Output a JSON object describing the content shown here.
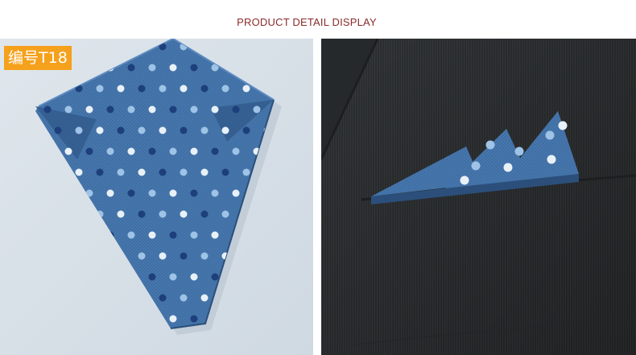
{
  "header": {
    "title": "PRODUCT DETAIL DISPLAY"
  },
  "left_panel": {
    "badge_label": "编号T18",
    "subject": "blue polka-dot pocket square, flat",
    "colors": {
      "background": "#d9e1e8",
      "fabric": "#3f6ea3",
      "dot_light": "#e9f1f8",
      "dot_mid": "#9ec3e6",
      "dot_dark": "#1d3f7c"
    }
  },
  "right_panel": {
    "subject": "pocket square folded in suit breast pocket",
    "colors": {
      "suit": "#2e3133",
      "fabric": "#3f6ea3"
    }
  },
  "colors": {
    "header_text": "#8a2b2b",
    "badge_bg": "#f5a11c",
    "badge_text": "#ffffff"
  }
}
